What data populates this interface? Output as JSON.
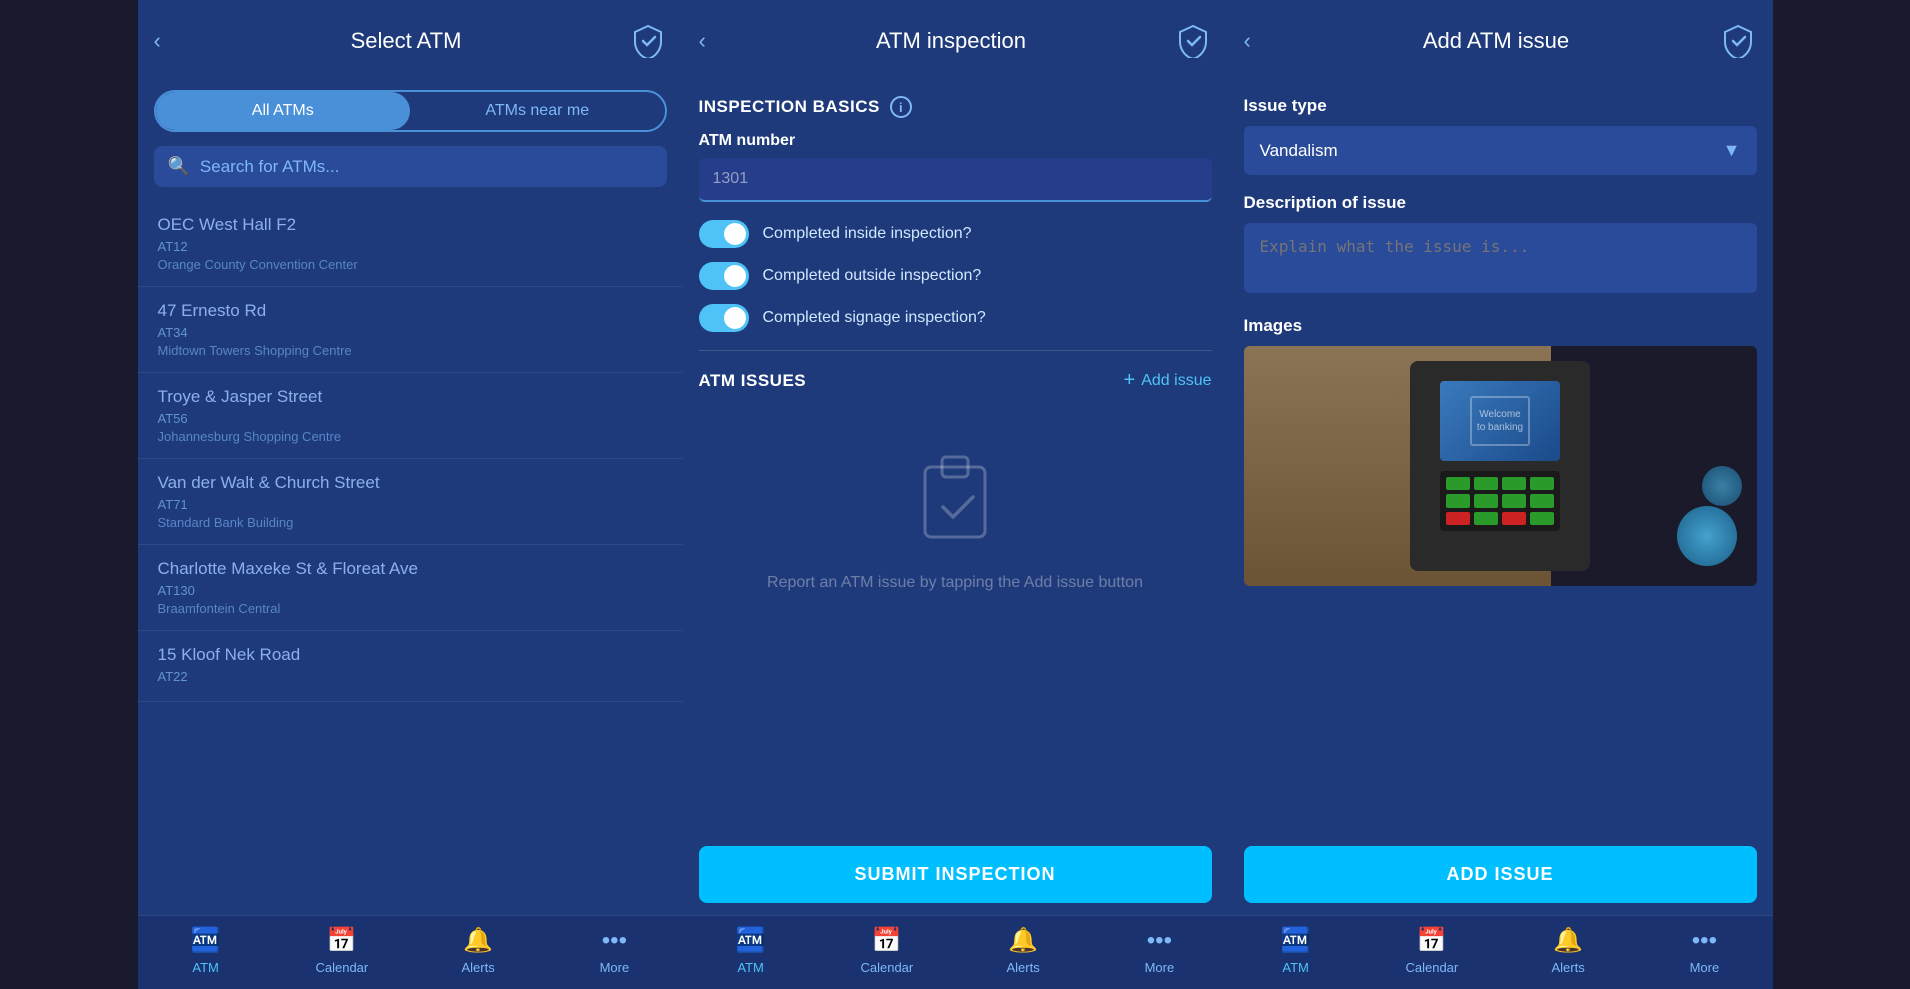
{
  "screens": [
    {
      "id": "select-atm",
      "header": {
        "back_label": "‹",
        "title": "Select ATM",
        "shield": true
      },
      "tabs": {
        "all_label": "All ATMs",
        "near_label": "ATMs near me",
        "active": "all"
      },
      "search": {
        "placeholder": "Search for ATMs..."
      },
      "atm_list": [
        {
          "name": "OEC West Hall F2",
          "code": "AT12",
          "location": "Orange County Convention Center"
        },
        {
          "name": "47 Ernesto Rd",
          "code": "AT34",
          "location": "Midtown Towers Shopping Centre"
        },
        {
          "name": "Troye & Jasper Street",
          "code": "AT56",
          "location": "Johannesburg Shopping Centre"
        },
        {
          "name": "Van der Walt & Church Street",
          "code": "AT71",
          "location": "Standard Bank Building"
        },
        {
          "name": "Charlotte Maxeke St & Floreat Ave",
          "code": "AT130",
          "location": "Braamfontein Central"
        },
        {
          "name": "15 Kloof Nek Road",
          "code": "AT22",
          "location": ""
        }
      ],
      "nav": {
        "items": [
          {
            "icon": "atm",
            "label": "ATM",
            "active": true
          },
          {
            "icon": "calendar",
            "label": "Calendar",
            "active": false
          },
          {
            "icon": "bell",
            "label": "Alerts",
            "active": false
          },
          {
            "icon": "more",
            "label": "More",
            "active": false
          }
        ]
      }
    },
    {
      "id": "atm-inspection",
      "header": {
        "back_label": "‹",
        "title": "ATM inspection",
        "shield": true
      },
      "sections": {
        "basics_title": "INSPECTION BASICS",
        "atm_number_label": "ATM number",
        "atm_number_value": "1301",
        "toggles": [
          {
            "label": "Completed inside inspection?",
            "checked": true
          },
          {
            "label": "Completed outside inspection?",
            "checked": true
          },
          {
            "label": "Completed signage inspection?",
            "checked": true
          }
        ],
        "issues_title": "ATM ISSUES",
        "add_issue_label": "Add issue",
        "empty_text": "Report an ATM issue by\ntapping the Add issue button"
      },
      "submit_label": "SUBMIT INSPECTION",
      "nav": {
        "items": [
          {
            "icon": "atm",
            "label": "ATM",
            "active": true
          },
          {
            "icon": "calendar",
            "label": "Calendar",
            "active": false
          },
          {
            "icon": "bell",
            "label": "Alerts",
            "active": false
          },
          {
            "icon": "more",
            "label": "More",
            "active": false
          }
        ]
      }
    },
    {
      "id": "add-atm-issue",
      "header": {
        "back_label": "‹",
        "title": "Add ATM issue",
        "shield": true
      },
      "form": {
        "issue_type_label": "Issue type",
        "issue_type_value": "Vandalism",
        "description_label": "Description of issue",
        "description_placeholder": "Explain what the issue is...",
        "images_label": "Images"
      },
      "add_issue_btn": "ADD ISSUE",
      "nav": {
        "items": [
          {
            "icon": "atm",
            "label": "ATM",
            "active": true
          },
          {
            "icon": "calendar",
            "label": "Calendar",
            "active": false
          },
          {
            "icon": "bell",
            "label": "Alerts",
            "active": false
          },
          {
            "icon": "more",
            "label": "More",
            "active": false
          }
        ]
      }
    }
  ]
}
